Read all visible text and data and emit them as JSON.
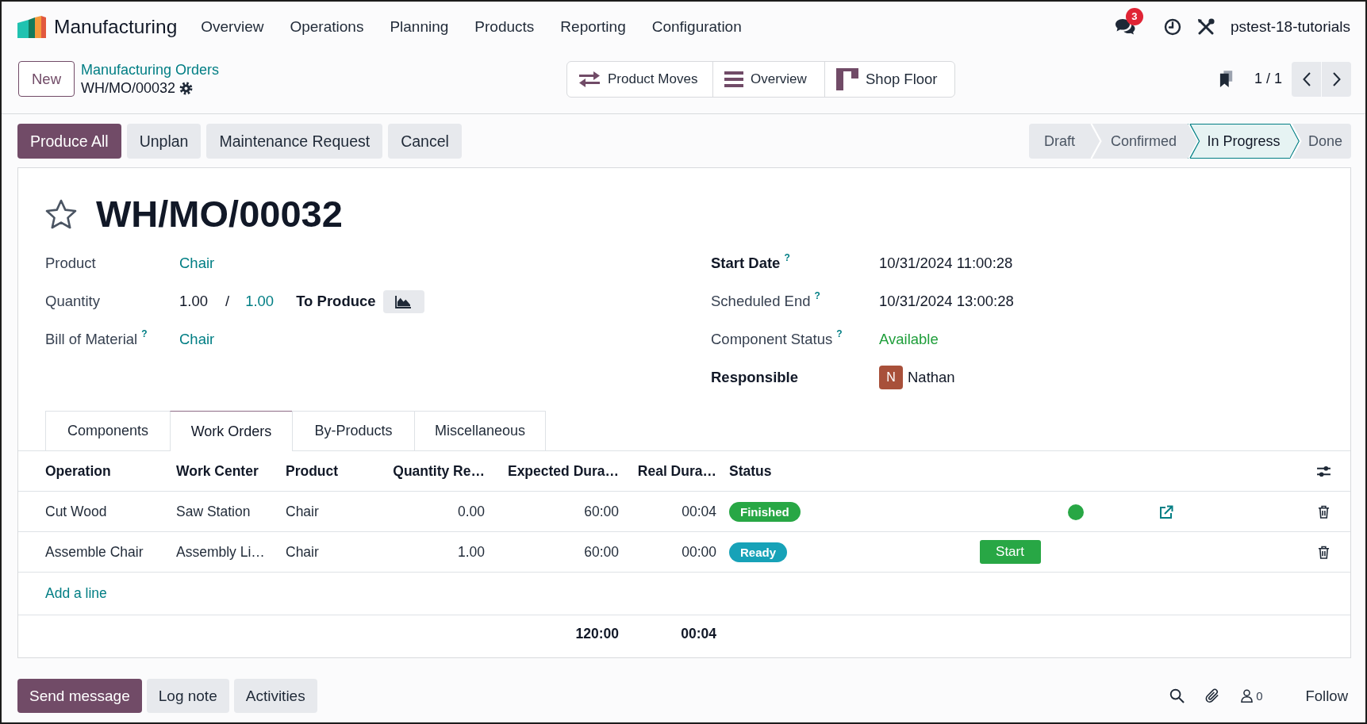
{
  "navbar": {
    "app_name": "Manufacturing",
    "menu": [
      {
        "label": "Overview"
      },
      {
        "label": "Operations"
      },
      {
        "label": "Planning"
      },
      {
        "label": "Products"
      },
      {
        "label": "Reporting"
      },
      {
        "label": "Configuration"
      }
    ],
    "messages_badge": "3",
    "user": "pstest-18-tutorials"
  },
  "control_panel": {
    "new_button": "New",
    "breadcrumb": "Manufacturing Orders",
    "record_name": "WH/MO/00032",
    "smart_buttons": [
      {
        "kind": "moves",
        "label": "Product Moves"
      },
      {
        "kind": "overview",
        "label": "Overview"
      },
      {
        "kind": "shop_floor",
        "label": "Shop Floor"
      }
    ],
    "pager": "1 / 1"
  },
  "action_buttons": [
    {
      "label": "Produce All",
      "primary": true
    },
    {
      "label": "Unplan",
      "primary": false
    },
    {
      "label": "Maintenance Request",
      "primary": false
    },
    {
      "label": "Cancel",
      "primary": false
    }
  ],
  "stages": [
    {
      "label": "Draft",
      "selected": false
    },
    {
      "label": "Confirmed",
      "selected": false
    },
    {
      "label": "In Progress",
      "selected": true
    },
    {
      "label": "Done",
      "selected": false
    }
  ],
  "record": {
    "title": "WH/MO/00032",
    "starred": false,
    "left_fields": [
      {
        "kind": "link",
        "label": "Product",
        "required": false,
        "value": "Chair"
      },
      {
        "kind": "quantity",
        "label": "Quantity",
        "required": false,
        "value": "1.00",
        "separator": "/",
        "target": "1.00",
        "unit_label": "To Produce"
      },
      {
        "kind": "link",
        "label": "Bill of Material",
        "required": false,
        "help": "?",
        "value": "Chair"
      }
    ],
    "right_fields": [
      {
        "kind": "text",
        "label": "Start Date",
        "required": true,
        "help": "?",
        "value": "10/31/2024 11:00:28"
      },
      {
        "kind": "text",
        "label": "Scheduled End",
        "required": false,
        "help": "?",
        "value": "10/31/2024 13:00:28"
      },
      {
        "kind": "success",
        "label": "Component Status",
        "required": false,
        "help": "?",
        "value": "Available"
      },
      {
        "kind": "user",
        "label": "Responsible",
        "required": true,
        "avatar_initial": "N",
        "value": "Nathan"
      }
    ]
  },
  "tabs": [
    {
      "label": "Components",
      "selected": false
    },
    {
      "label": "Work Orders",
      "selected": true
    },
    {
      "label": "By-Products",
      "selected": false
    },
    {
      "label": "Miscellaneous",
      "selected": false
    }
  ],
  "work_orders": {
    "columns": [
      {
        "label": "Operation",
        "numeric": false
      },
      {
        "label": "Work Center",
        "numeric": false
      },
      {
        "label": "Product",
        "numeric": false
      },
      {
        "label": "Quantity Re…",
        "numeric": true
      },
      {
        "label": "Expected Dura…",
        "numeric": true,
        "total": "120:00"
      },
      {
        "label": "Real Dura…",
        "numeric": true,
        "total": "00:04"
      },
      {
        "label": "Status",
        "numeric": false
      }
    ],
    "rows": [
      {
        "cells": [
          "Cut Wood",
          "Saw Station",
          "Chair",
          "0.00",
          "60:00",
          "00:04"
        ],
        "status": {
          "label": "Finished",
          "color": "#28a745"
        },
        "finished": true
      },
      {
        "cells": [
          "Assemble Chair",
          "Assembly Li…",
          "Chair",
          "1.00",
          "60:00",
          "00:00"
        ],
        "status": {
          "label": "Ready",
          "color": "#17a2b8"
        },
        "action": "Start"
      }
    ],
    "add_line": "Add a line"
  },
  "chatter": {
    "buttons": [
      {
        "label": "Send message",
        "primary": true
      },
      {
        "label": "Log note",
        "primary": false
      },
      {
        "label": "Activities",
        "primary": false
      }
    ],
    "followers": "0",
    "follow": "Follow"
  }
}
